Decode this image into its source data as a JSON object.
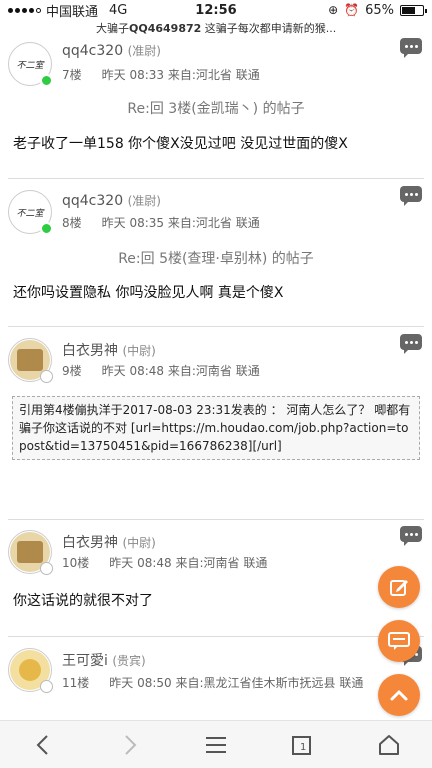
{
  "status": {
    "carrier": "中国联通",
    "network": "4G",
    "time": "12:56",
    "battery": "65%",
    "battery_level": 0.65
  },
  "marquee": {
    "prefix": "大骗子",
    "qq": "QQ4649872",
    "text": "这骗子每次都申请新的猴..."
  },
  "posts": [
    {
      "username": "qq4c320",
      "rank": "(准尉)",
      "floor": "7楼",
      "time": "昨天 08:33",
      "from": "来自:河北省 联通",
      "reply_to": "Re:回 3楼(金凯瑞丶) 的帖子",
      "content": "老子收了一单158  你个傻X没见过吧  没见过世面的傻X",
      "online": true
    },
    {
      "username": "qq4c320",
      "rank": "(准尉)",
      "floor": "8楼",
      "time": "昨天 08:35",
      "from": "来自:河北省 联通",
      "reply_to": "Re:回 5楼(查理·卓别林) 的帖子",
      "content": "还你吗设置隐私  你吗没脸见人啊  真是个傻X",
      "online": true
    },
    {
      "username": "白衣男神",
      "rank": "(中尉)",
      "floor": "9楼",
      "time": "昨天 08:48",
      "from": "来自:河南省 联通",
      "quote": "引用第4楼傰执洋于2017-08-03 23:31发表的 ： 河南人怎么了？ 唧都有骗子你这话说的不对 [url=https://m.houdao.com/job.php?action=topost&tid=13750451&pid=166786238][/url]",
      "online": false
    },
    {
      "username": "白衣男神",
      "rank": "(中尉)",
      "floor": "10楼",
      "time": "昨天 08:48",
      "from": "来自:河南省 联通",
      "content": "你这话说的就很不对了",
      "online": false
    },
    {
      "username": "王可愛i",
      "rank": "(贵宾)",
      "floor": "11楼",
      "time": "昨天 08:50",
      "from": "来自:黑龙江省佳木斯市抚远县 联通",
      "online": false
    }
  ],
  "avatar_text": "不二室",
  "colors": {
    "accent": "#f4873a",
    "online": "#2ecc40"
  }
}
